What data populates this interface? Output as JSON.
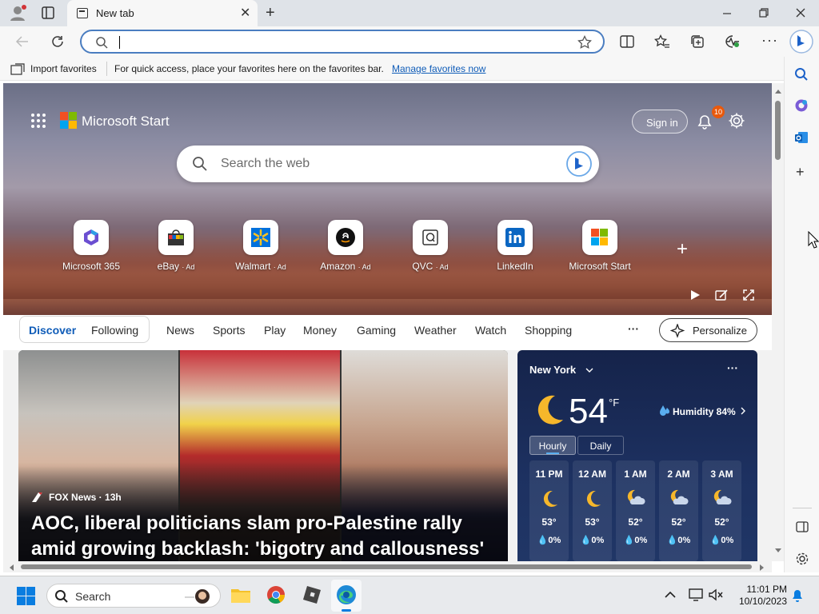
{
  "browser": {
    "tab_title": "New tab",
    "address_value": "",
    "favorites_bar": {
      "import_label": "Import favorites",
      "hint": "For quick access, place your favorites here on the favorites bar.",
      "manage_link": "Manage favorites now"
    }
  },
  "page": {
    "brand": "Microsoft Start",
    "sign_in": "Sign in",
    "notification_count": "10",
    "search_placeholder": "Search the web",
    "quick_links": [
      {
        "label": "Microsoft 365",
        "ad": ""
      },
      {
        "label": "eBay",
        "ad": "· Ad"
      },
      {
        "label": "Walmart",
        "ad": "· Ad"
      },
      {
        "label": "Amazon",
        "ad": "· Ad"
      },
      {
        "label": "QVC",
        "ad": "· Ad"
      },
      {
        "label": "LinkedIn",
        "ad": ""
      },
      {
        "label": "Microsoft Start",
        "ad": ""
      }
    ],
    "nav": [
      "Discover",
      "Following",
      "News",
      "Sports",
      "Play",
      "Money",
      "Gaming",
      "Weather",
      "Watch",
      "Shopping"
    ],
    "more_label": "···",
    "personalize": "Personalize",
    "news": {
      "source": "FOX News · 13h",
      "headline": "AOC, liberal politicians slam pro-Palestine rally amid growing backlash: 'bigotry and callousness'"
    },
    "weather": {
      "city": "New York",
      "temp": "54",
      "unit": "°F",
      "humidity": "Humidity 84%",
      "tabs": [
        "Hourly",
        "Daily"
      ],
      "hours": [
        {
          "time": "11 PM",
          "temp": "53°",
          "precip": "0%",
          "icon": "moon"
        },
        {
          "time": "12 AM",
          "temp": "53°",
          "precip": "0%",
          "icon": "moon"
        },
        {
          "time": "1 AM",
          "temp": "52°",
          "precip": "0%",
          "icon": "moon-cloud"
        },
        {
          "time": "2 AM",
          "temp": "52°",
          "precip": "0%",
          "icon": "moon-cloud"
        },
        {
          "time": "3 AM",
          "temp": "52°",
          "precip": "0%",
          "icon": "moon-cloud"
        }
      ]
    }
  },
  "taskbar": {
    "search_label": "Search",
    "time": "11:01 PM",
    "date": "10/10/2023"
  },
  "colors": {
    "accent": "#0f5cb8",
    "weather_bg": "#1d3161"
  }
}
